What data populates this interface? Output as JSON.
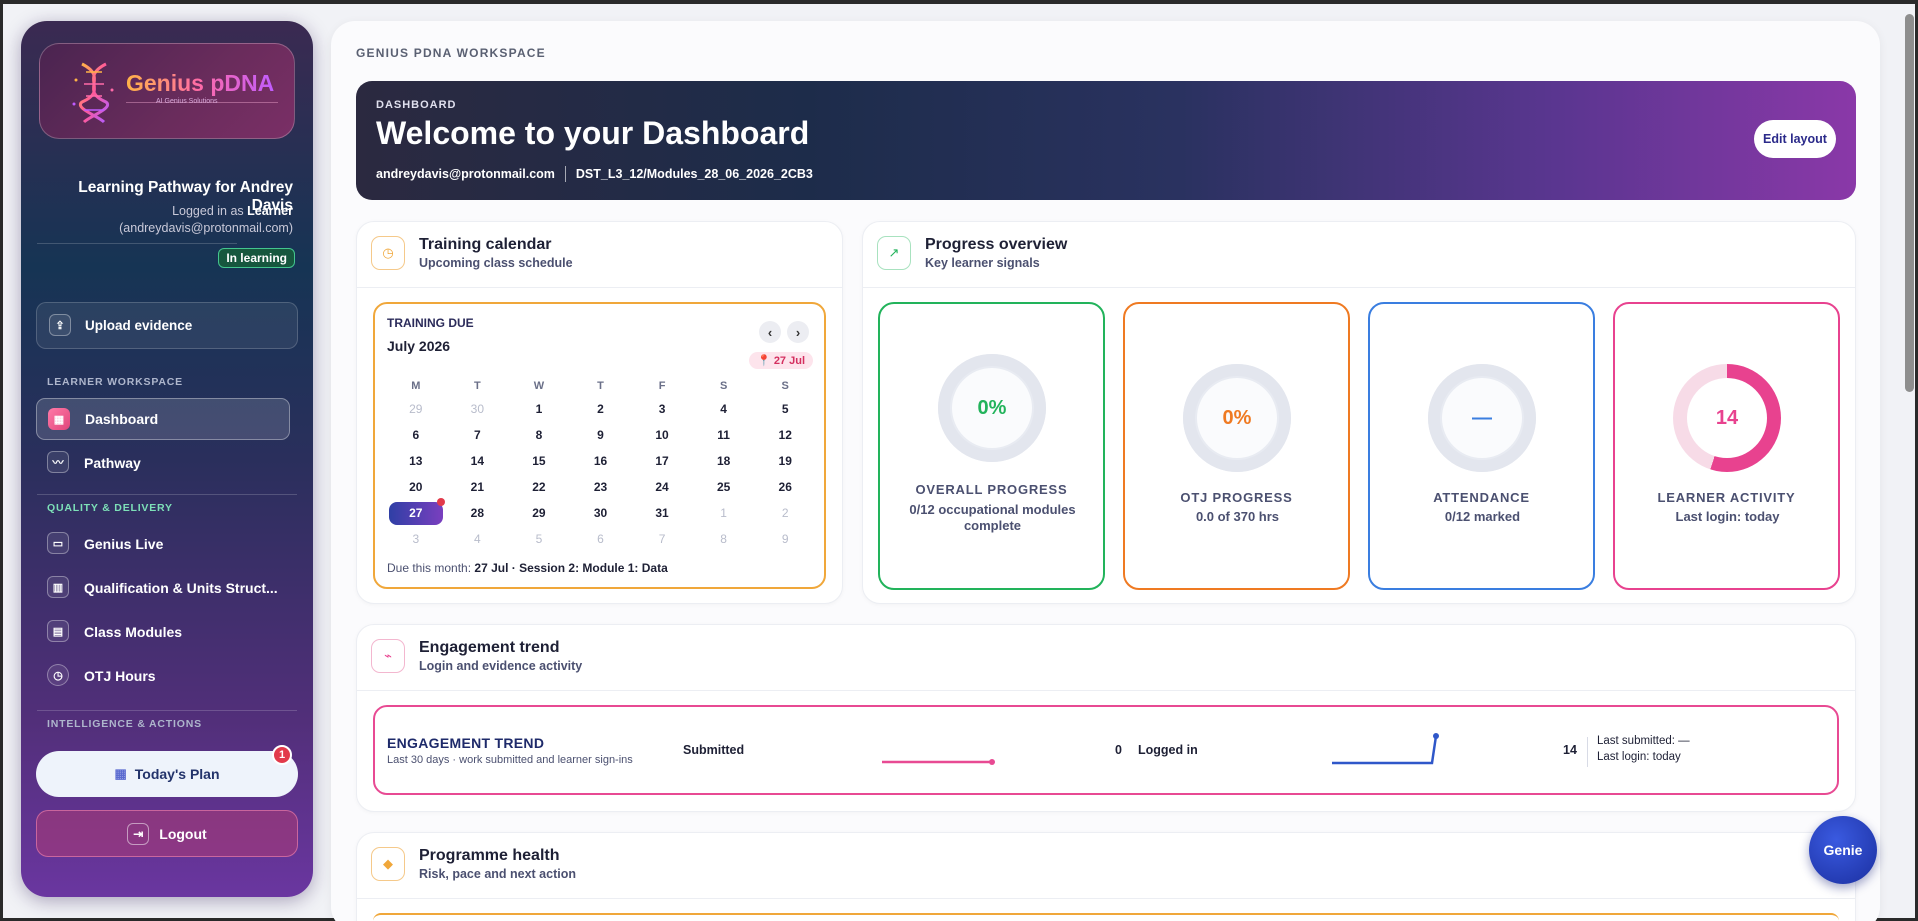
{
  "sidebar": {
    "logo": {
      "title": "Genius pDNA",
      "subtitle": "AI Genius Solutions"
    },
    "pathway_title": "Learning Pathway for Andrey Davis",
    "logged_in_prefix": "Logged in as",
    "logged_in_role": "Learner",
    "logged_in_email": "(andreydavis@protonmail.com)",
    "status_badge": "In learning",
    "upload_label": "Upload evidence",
    "sections": {
      "workspace": "LEARNER WORKSPACE",
      "quality": "QUALITY & DELIVERY",
      "intelligence": "INTELLIGENCE & ACTIONS"
    },
    "nav": [
      {
        "label": "Dashboard",
        "icon": "dashboard-icon",
        "active": true
      },
      {
        "label": "Pathway",
        "icon": "pathway-icon"
      },
      {
        "label": "Genius Live",
        "icon": "video-icon"
      },
      {
        "label": "Qualification & Units Struct...",
        "icon": "book-icon"
      },
      {
        "label": "Class Modules",
        "icon": "calendar-icon"
      },
      {
        "label": "OTJ Hours",
        "icon": "clock-icon"
      }
    ],
    "todays_plan": {
      "label": "Today's Plan",
      "badge": "1",
      "icon": "calendar-emoji-icon"
    },
    "logout_label": "Logout"
  },
  "main": {
    "workspace_label": "GENIUS PDNA WORKSPACE",
    "hero": {
      "label": "DASHBOARD",
      "title": "Welcome to your Dashboard",
      "email": "andreydavis@protonmail.com",
      "cohort": "DST_L3_12/Modules_28_06_2026_2CB3",
      "edit_button": "Edit layout"
    },
    "training_calendar": {
      "title": "Training calendar",
      "subtitle": "Upcoming class schedule",
      "label": "TRAINING DUE",
      "month": "July 2026",
      "due_chip": "27 Jul",
      "weekdays": [
        "M",
        "T",
        "W",
        "T",
        "F",
        "S",
        "S"
      ],
      "days": [
        "29",
        "30",
        "1",
        "2",
        "3",
        "4",
        "5",
        "6",
        "7",
        "8",
        "9",
        "10",
        "11",
        "12",
        "13",
        "14",
        "15",
        "16",
        "17",
        "18",
        "19",
        "20",
        "21",
        "22",
        "23",
        "24",
        "25",
        "26",
        "27",
        "28",
        "29",
        "30",
        "31",
        "1",
        "2",
        "3",
        "4",
        "5",
        "6",
        "7",
        "8",
        "9"
      ],
      "muted_indices": [
        0,
        1,
        33,
        34,
        35,
        36,
        37,
        38,
        39,
        40,
        41
      ],
      "today_index": 28,
      "footer_prefix": "Due this month:",
      "footer_value": "27 Jul · Session 2: Module 1: Data"
    },
    "progress_overview": {
      "title": "Progress overview",
      "subtitle": "Key learner signals",
      "cards": [
        {
          "value": "0%",
          "label": "OVERALL PROGRESS",
          "detail": "0/12 occupational modules complete",
          "color": "#22b35b"
        },
        {
          "value": "0%",
          "label": "OTJ PROGRESS",
          "detail": "0.0 of 370 hrs",
          "color": "#ef7a22"
        },
        {
          "value": "—",
          "label": "ATTENDANCE",
          "detail": "0/12 marked",
          "color": "#3a7ee0"
        },
        {
          "value": "14",
          "label": "LEARNER ACTIVITY",
          "detail": "Last login: today",
          "color": "#e8428f"
        }
      ]
    },
    "engagement": {
      "title": "Engagement trend",
      "subtitle": "Login and evidence activity",
      "panel_title": "ENGAGEMENT TREND",
      "panel_subtitle": "Last 30 days · work submitted and learner sign-ins",
      "submitted_label": "Submitted",
      "submitted_value": "0",
      "logged_in_label": "Logged in",
      "logged_in_value": "14",
      "last_submitted": "Last submitted: —",
      "last_login": "Last login: today"
    },
    "programme_health": {
      "title": "Programme health",
      "subtitle": "Risk, pace and next action"
    }
  },
  "genie_label": "Genie"
}
